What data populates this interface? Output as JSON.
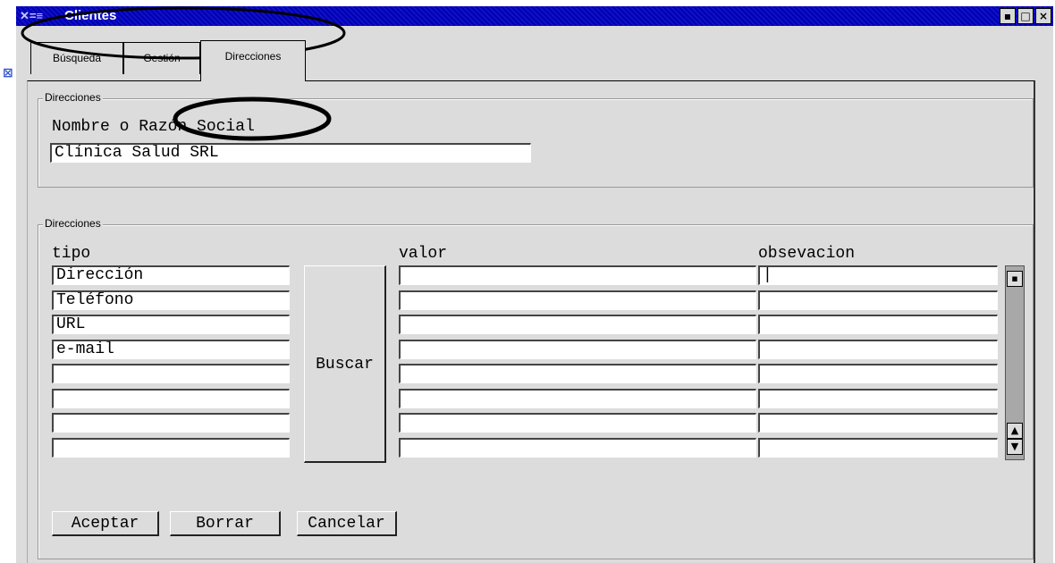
{
  "window": {
    "title": "Clientes",
    "controls": [
      "▪",
      "□",
      "×"
    ]
  },
  "tabs": [
    {
      "label": "Búsqueda",
      "active": false
    },
    {
      "label": "Gestión",
      "active": false
    },
    {
      "label": "Direcciones",
      "active": true
    }
  ],
  "group1": {
    "legend": "Direcciones",
    "name_label": "Nombre o Razón Social",
    "name_value": "Clínica Salud SRL"
  },
  "group2": {
    "legend": "Direcciones",
    "col_tipo": "tipo",
    "col_valor": "valor",
    "col_obs": "obsevacion",
    "rows": [
      {
        "tipo": "Dirección",
        "valor": "",
        "obs": "|"
      },
      {
        "tipo": "Teléfono",
        "valor": "",
        "obs": ""
      },
      {
        "tipo": "URL",
        "valor": "",
        "obs": ""
      },
      {
        "tipo": "e-mail",
        "valor": "",
        "obs": ""
      },
      {
        "tipo": "",
        "valor": "",
        "obs": ""
      },
      {
        "tipo": "",
        "valor": "",
        "obs": ""
      },
      {
        "tipo": "",
        "valor": "",
        "obs": ""
      },
      {
        "tipo": "",
        "valor": "",
        "obs": ""
      }
    ],
    "buscar_label": "Buscar"
  },
  "buttons": {
    "aceptar": "Aceptar",
    "borrar": "Borrar",
    "cancelar": "Cancelar"
  },
  "scrollbar": {
    "top_icon": "▪",
    "up_icon": "▲",
    "down_icon": "▼"
  }
}
